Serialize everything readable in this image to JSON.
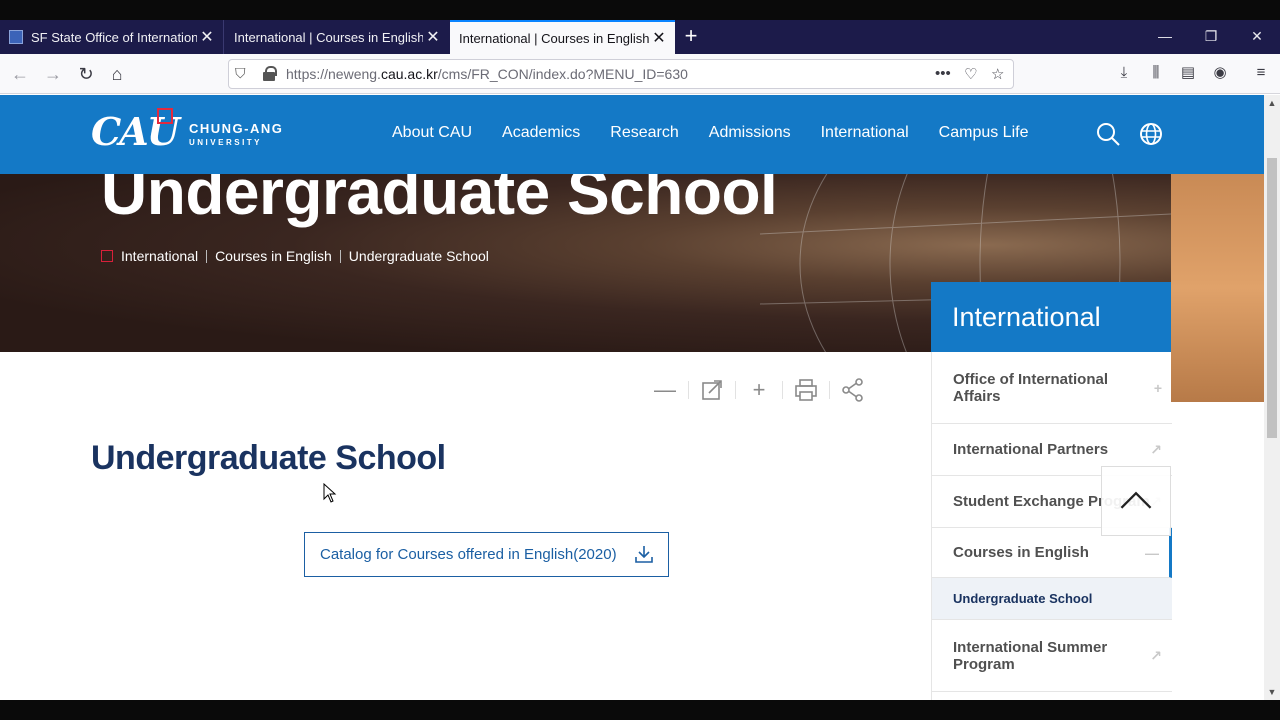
{
  "browser": {
    "tabs": [
      {
        "title": "SF State Office of International"
      },
      {
        "title": "International | Courses in English | U"
      },
      {
        "title": "International | Courses in English | U"
      }
    ],
    "url_prefix": "https://neweng.",
    "url_domain": "cau.ac.kr",
    "url_path": "/cms/FR_CON/index.do?MENU_ID=630"
  },
  "site": {
    "logo_main": "CAU",
    "logo_name": "CHUNG-ANG",
    "logo_sub": "UNIVERSITY",
    "menu": [
      "About CAU",
      "Academics",
      "Research",
      "Admissions",
      "International",
      "Campus Life"
    ],
    "brand_color": "#1479c6"
  },
  "hero": {
    "title": "Undergraduate School",
    "breadcrumbs": [
      "International",
      "Courses in English",
      "Undergraduate School"
    ]
  },
  "content": {
    "title": "Undergraduate School",
    "catalog_button": "Catalog for Courses offered in English(2020)"
  },
  "sidebar": {
    "heading": "International",
    "items": [
      {
        "label": "Office of International Affairs",
        "icon": "plus-icon"
      },
      {
        "label": "International Partners",
        "icon": "external-link-icon"
      },
      {
        "label": "Student Exchange Program",
        "icon": "external-link-icon"
      },
      {
        "label": "Courses in English",
        "icon": "minus-icon"
      },
      {
        "label": "Undergraduate School",
        "icon": ""
      },
      {
        "label": "International Summer Program",
        "icon": "external-link-icon"
      }
    ]
  }
}
